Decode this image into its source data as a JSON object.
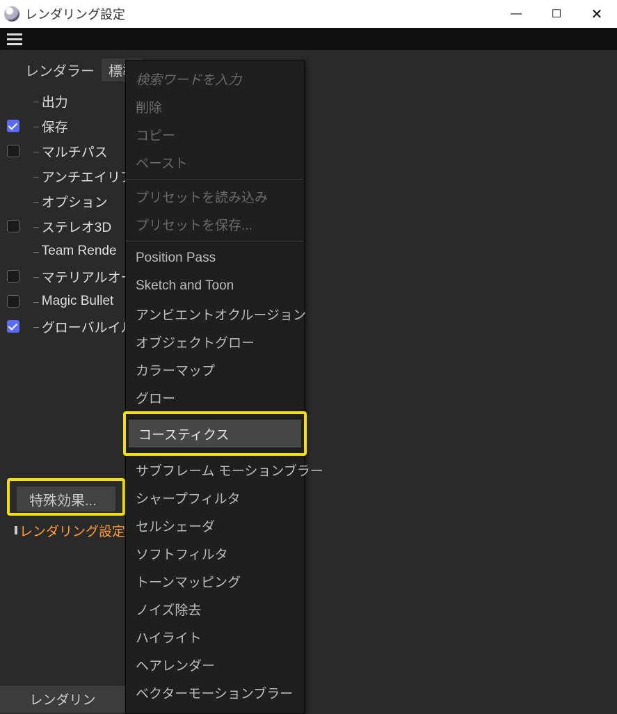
{
  "window": {
    "title": "レンダリング設定"
  },
  "renderer": {
    "label": "レンダラー",
    "value": "標準"
  },
  "tree": {
    "items": [
      {
        "label": "出力",
        "hasChk": false,
        "checked": false
      },
      {
        "label": "保存",
        "hasChk": true,
        "checked": true
      },
      {
        "label": "マルチパス",
        "hasChk": true,
        "checked": false
      },
      {
        "label": "アンチエイリア",
        "hasChk": false,
        "checked": false
      },
      {
        "label": "オプション",
        "hasChk": false,
        "checked": false
      },
      {
        "label": "ステレオ3D",
        "hasChk": true,
        "checked": false
      },
      {
        "label": "Team Rende",
        "hasChk": false,
        "checked": false
      },
      {
        "label": "マテリアルオー",
        "hasChk": true,
        "checked": false
      },
      {
        "label": "Magic Bullet",
        "hasChk": true,
        "checked": false
      },
      {
        "label": "グローバルイル",
        "hasChk": true,
        "checked": true
      }
    ]
  },
  "effects_button": "特殊効果...",
  "render_settings_link": "レンダリング設定",
  "footer_button": "レンダリン",
  "popup": {
    "search_placeholder": "検索ワードを入力",
    "group1": [
      "削除",
      "コピー",
      "ペースト"
    ],
    "group2": [
      "プリセットを読み込み",
      "プリセットを保存..."
    ],
    "effects": [
      "Position Pass",
      "Sketch and Toon",
      "アンビエントオクルージョン",
      "オブジェクトグロー",
      "カラーマップ",
      "グロー",
      "コースティクス",
      "サブフレーム モーションブラー",
      "シャープフィルタ",
      "セルシェーダ",
      "ソフトフィルタ",
      "トーンマッピング",
      "ノイズ除去",
      "ハイライト",
      "ヘアレンダー",
      "ベクターモーションブラー"
    ],
    "highlighted_index": 6
  }
}
